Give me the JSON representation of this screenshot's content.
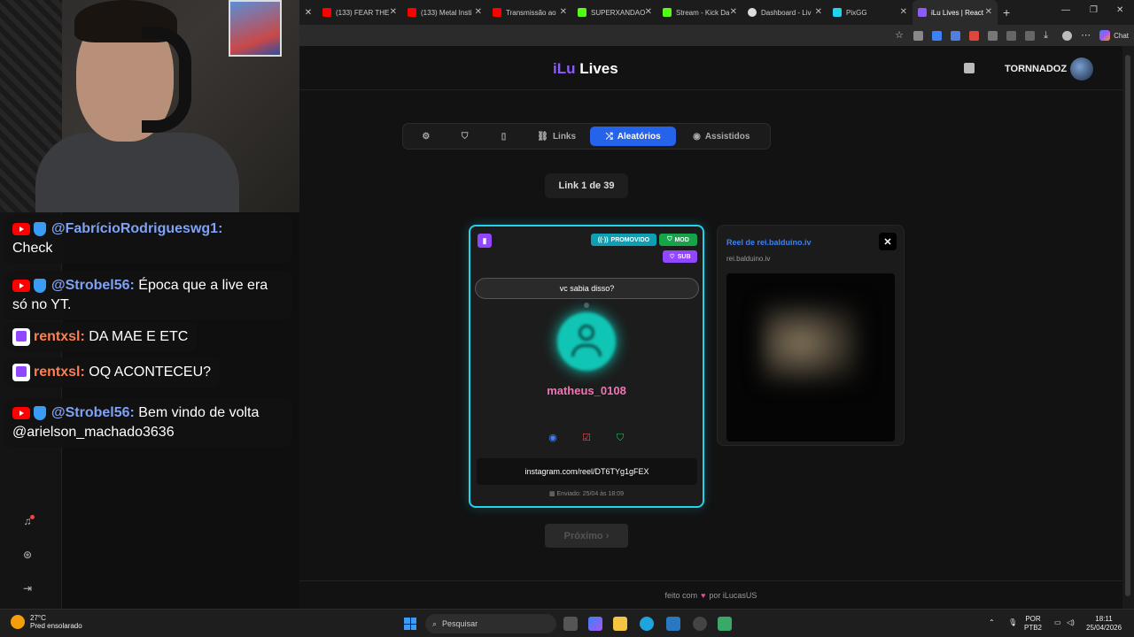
{
  "browser": {
    "tabs": [
      {
        "label": "(133) FEAR THE",
        "color": "#ff0000"
      },
      {
        "label": "(133) Metal Insti",
        "color": "#ff0000"
      },
      {
        "label": "Transmissão ao",
        "color": "#ff0000"
      },
      {
        "label": "SUPERXANDAO",
        "color": "#53fc18"
      },
      {
        "label": "Stream - Kick Da",
        "color": "#53fc18"
      },
      {
        "label": "Dashboard - Liv",
        "color": "#dddddd"
      },
      {
        "label": "PixGG",
        "color": "#22d3ee"
      },
      {
        "label": "iLu Lives | React",
        "color": "#8b5cf6"
      }
    ],
    "chat_label": "Chat"
  },
  "app": {
    "logo_prefix": "iLu",
    "logo_suffix": " Lives",
    "username": "TORNNADOZ",
    "nav": {
      "links": "Links",
      "aleatorios": "Aleatórios",
      "assistidos": "Assistidos"
    },
    "counter": "Link 1 de 39",
    "card": {
      "tag_promo": "PROMOVIDO",
      "tag_mod": "MOD",
      "tag_sub": "SUB",
      "question": "vc sabia disso?",
      "user": "matheus_0108",
      "link": "instagram.com/reel/DT6TYg1gFEX",
      "sent": "Enviado: 25/04 às 18:09"
    },
    "reel": {
      "title": "Reel de rei.balduino.iv",
      "subtitle": "rei.balduino.iv"
    },
    "next_label": "Próximo ›",
    "footer": {
      "before": "feito com",
      "heart": "♥",
      "after": "por iLucasUS"
    }
  },
  "chat": [
    {
      "platform": "youtube",
      "name": "@FabrícioRodrigueswg1:",
      "name_color": "#7ea2f5",
      "text": "Check"
    },
    {
      "platform": "youtube",
      "name": "@Strobel56:",
      "name_color": "#7ea2f5",
      "text": "Época que a live era só no YT."
    },
    {
      "platform": "twitch",
      "name": "rentxsl:",
      "name_color": "#ff7f50",
      "text": "DA MAE E ETC"
    },
    {
      "platform": "twitch",
      "name": "rentxsl:",
      "name_color": "#ff7f50",
      "text": "OQ ACONTECEU?"
    },
    {
      "platform": "youtube",
      "name": "@Strobel56:",
      "name_color": "#7ea2f5",
      "text": "Bem vindo de volta @arielson_machado3636"
    }
  ],
  "taskbar": {
    "temp": "27°C",
    "weather": "Pred ensolarado",
    "search": "Pesquisar",
    "lang": "POR",
    "layout": "PTB2",
    "time": "18:11",
    "date": "25/04/2026"
  }
}
